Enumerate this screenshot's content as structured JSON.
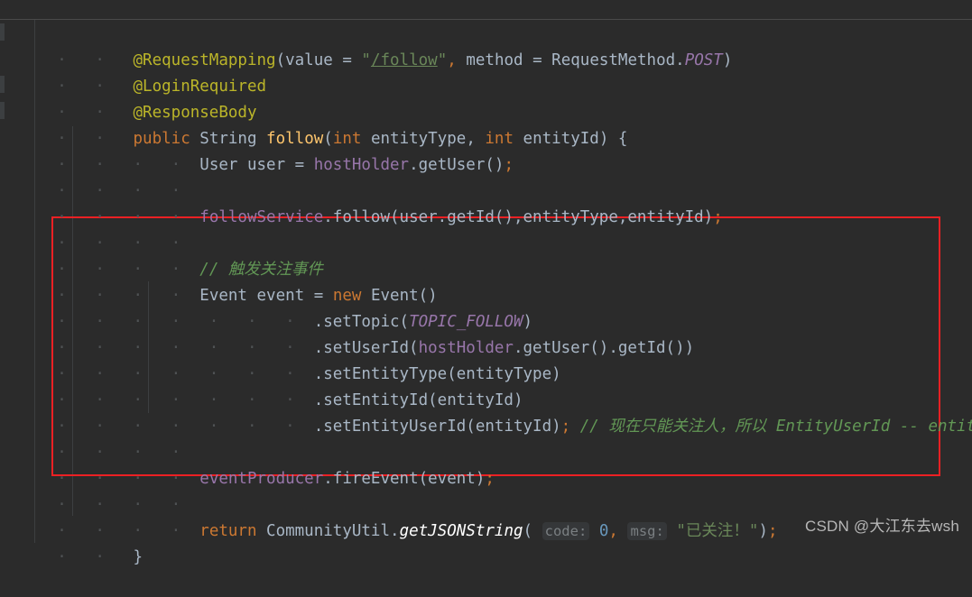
{
  "editor": {
    "background_color": "#2b2b2b",
    "default_text_color": "#a9b7c6",
    "annotation_box_color": "#ec2024"
  },
  "code": {
    "line01": {
      "annotation": "@RequestMapping",
      "open_paren": "(",
      "param_value": "value",
      "eq1": " = ",
      "string_quote_open": "\"",
      "string_path": "/follow",
      "string_quote_close": "\"",
      "comma": ", ",
      "param_method": "method",
      "eq2": " = ",
      "class_requestmethod": "RequestMethod",
      "dot": ".",
      "const_post": "POST",
      "close_paren": ")"
    },
    "line02": {
      "annotation": "@LoginRequired"
    },
    "line03": {
      "annotation": "@ResponseBody"
    },
    "line04": {
      "kw_public": "public",
      "type_string": "String",
      "method_follow": "follow",
      "open_paren": "(",
      "kw_int1": "int",
      "arg1": " entityType, ",
      "kw_int2": "int",
      "arg2": " entityId",
      "close_paren": ")",
      "brace": " {"
    },
    "line05": {
      "type_user": "User",
      "var_user": " user ",
      "eq": "= ",
      "field_hostholder": "hostHolder",
      "call_getuser": ".getUser()",
      "semi": ";"
    },
    "line06": {
      "text": ""
    },
    "line07": {
      "field_followservice": "followService",
      "call": ".follow(user.getId(),entityType,entityId)",
      "semi": ";"
    },
    "line08": {
      "text": ""
    },
    "line09": {
      "comment": "// 触发关注事件"
    },
    "line10": {
      "type_event": "Event",
      "var_event": " event ",
      "eq": "= ",
      "kw_new": "new",
      "ctor": " Event()"
    },
    "line11": {
      "call": ".setTopic(",
      "const_topic": "TOPIC_FOLLOW",
      "close": ")"
    },
    "line12": {
      "call": ".setUserId(",
      "field_hostholder": "hostHolder",
      "rest": ".getUser().getId())"
    },
    "line13": {
      "call": ".setEntityType(entityType)"
    },
    "line14": {
      "call": ".setEntityId(entityId)"
    },
    "line15": {
      "call": ".setEntityUserId(entityId)",
      "semi": ";",
      "comment": "// 现在只能关注人，所以 EntityUserId -- entityId"
    },
    "line16": {
      "text": ""
    },
    "line17": {
      "field_eventproducer": "eventProducer",
      "call": ".fireEvent(event)",
      "semi": ";"
    },
    "line18": {
      "text": ""
    },
    "line19": {
      "kw_return": "return",
      "class_communityutil": " CommunityUtil",
      "dot": ".",
      "method_getjsonstring": "getJSONString",
      "open_paren": "(",
      "hint_code": "code:",
      "num_zero": "0",
      "comma": ",",
      "hint_msg": "msg:",
      "string_quote_open": "\"",
      "string_value": "已关注！",
      "string_quote_close": "\"",
      "close_paren": ")",
      "semi": ";"
    },
    "line20": {
      "brace": "}"
    }
  },
  "watermark": {
    "text": "CSDN @大江东去wsh"
  }
}
